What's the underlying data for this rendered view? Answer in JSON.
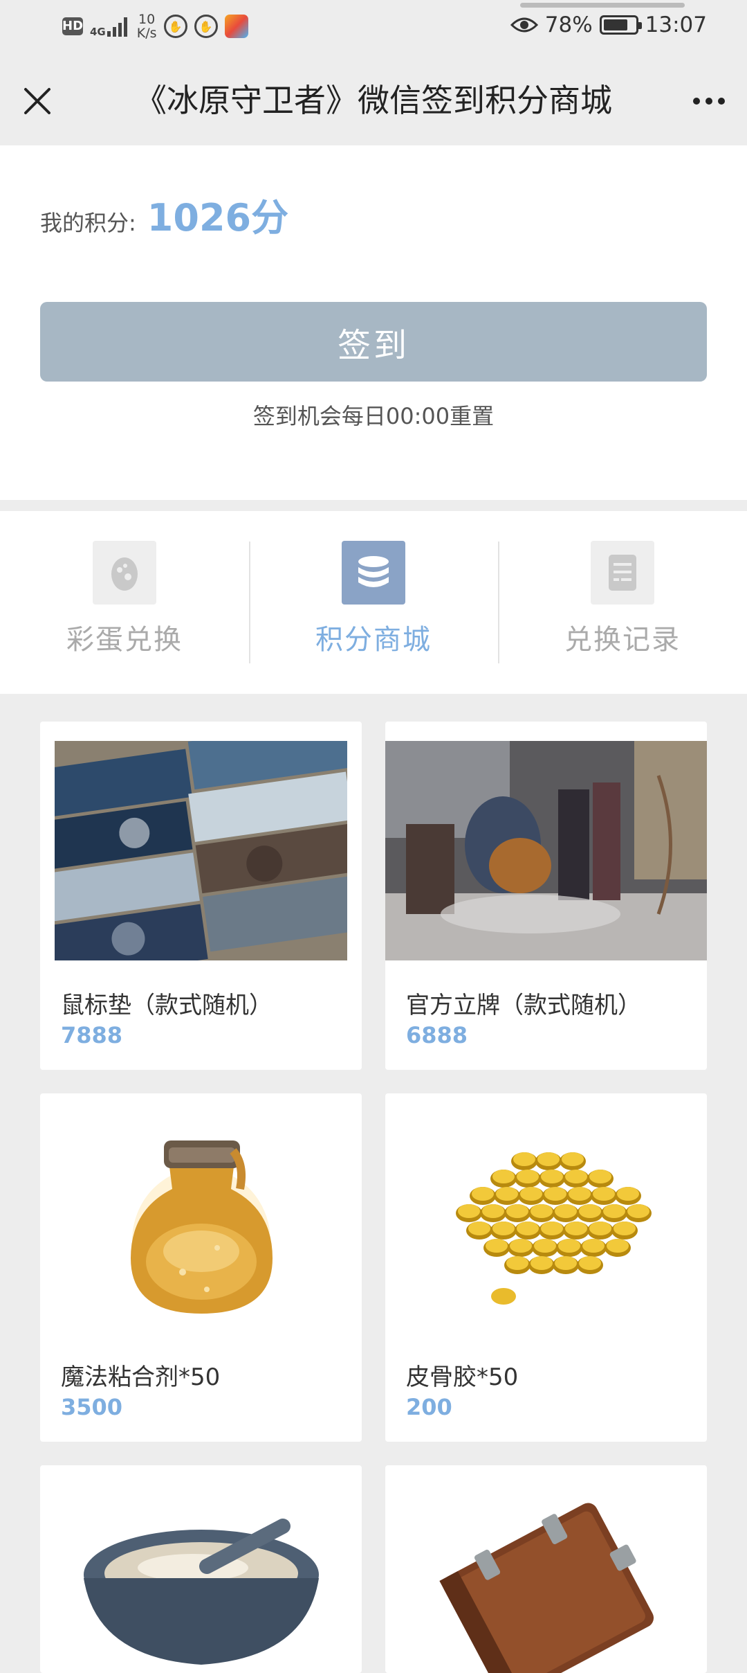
{
  "status_bar": {
    "hd": "HD",
    "network": "4G",
    "speed_value": "10",
    "speed_unit": "K/s",
    "battery": "78%",
    "battery_level": 0.78,
    "time": "13:07"
  },
  "nav": {
    "title": "《冰原守卫者》微信签到积分商城"
  },
  "points": {
    "label": "我的积分:",
    "value": "1026分"
  },
  "checkin": {
    "button_label": "签到",
    "hint": "签到机会每日00:00重置"
  },
  "tabs": [
    {
      "label": "彩蛋兑换",
      "icon": "egg-icon",
      "active": false
    },
    {
      "label": "积分商城",
      "icon": "database-icon",
      "active": true
    },
    {
      "label": "兑换记录",
      "icon": "document-icon",
      "active": false
    }
  ],
  "products": [
    {
      "name": "鼠标垫（款式随机）",
      "price": "7888",
      "image": "mousepad-photo"
    },
    {
      "name": "官方立牌（款式随机）",
      "price": "6888",
      "image": "acrylic-stand-photo"
    },
    {
      "name": "魔法粘合剂*50",
      "price": "3500",
      "image": "potion-bottle"
    },
    {
      "name": "皮骨胶*50",
      "price": "200",
      "image": "gold-coins"
    },
    {
      "name": "",
      "price": "",
      "image": "stone-bowl"
    },
    {
      "name": "",
      "price": "",
      "image": "leather-book"
    }
  ],
  "colors": {
    "accent": "#7eaee0",
    "checkin_button": "#a7b7c4",
    "active_tab_icon": "#8aa3c6",
    "background": "#ededed"
  }
}
